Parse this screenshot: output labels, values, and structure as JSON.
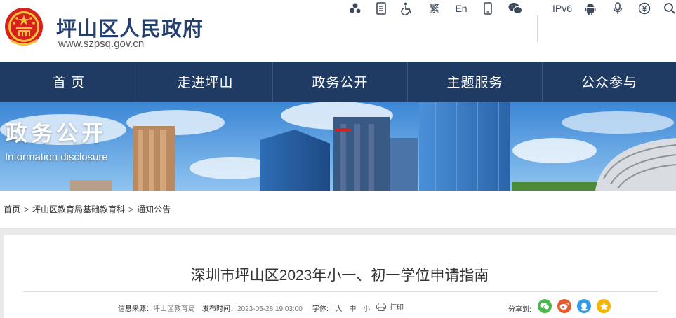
{
  "header": {
    "title": "坪山区人民政府",
    "url": "www.szpsq.gov.cn",
    "tools": {
      "traditional": "繁",
      "english": "En",
      "ipv6": "IPv6"
    }
  },
  "nav": {
    "items": [
      {
        "label": "首 页"
      },
      {
        "label": "走进坪山"
      },
      {
        "label": "政务公开"
      },
      {
        "label": "主题服务"
      },
      {
        "label": "公众参与"
      }
    ]
  },
  "banner": {
    "title": "政务公开",
    "subtitle": "Information disclosure"
  },
  "breadcrumb": {
    "items": [
      "首页",
      "坪山区教育局基础教育科",
      "通知公告"
    ],
    "separator": ">"
  },
  "article": {
    "title": "深圳市坪山区2023年小一、初一学位申请指南",
    "source_label": "信息来源：",
    "source": "坪山区教育局",
    "date_label": "发布时间：",
    "date": "2023-05-28 19:03:00",
    "font_label": "字体:",
    "font_sizes": [
      "大",
      "中",
      "小"
    ],
    "print": "打印",
    "share_label": "分享到:"
  },
  "colors": {
    "nav_bg": "#1f3b63",
    "title_blue": "#23406e",
    "emblem_red": "#d8201c",
    "emblem_gold": "#f3c33b",
    "wechat": "#4bb64a",
    "weibo": "#e85b2a",
    "qq": "#2f9be8",
    "qzone": "#f5b400"
  }
}
